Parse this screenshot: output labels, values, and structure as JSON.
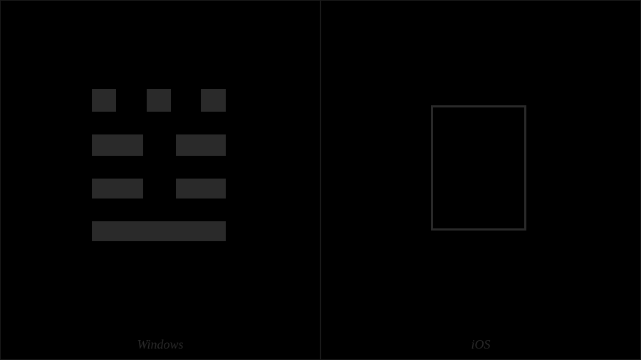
{
  "panels": {
    "left": {
      "label": "Windows"
    },
    "right": {
      "label": "iOS"
    }
  }
}
